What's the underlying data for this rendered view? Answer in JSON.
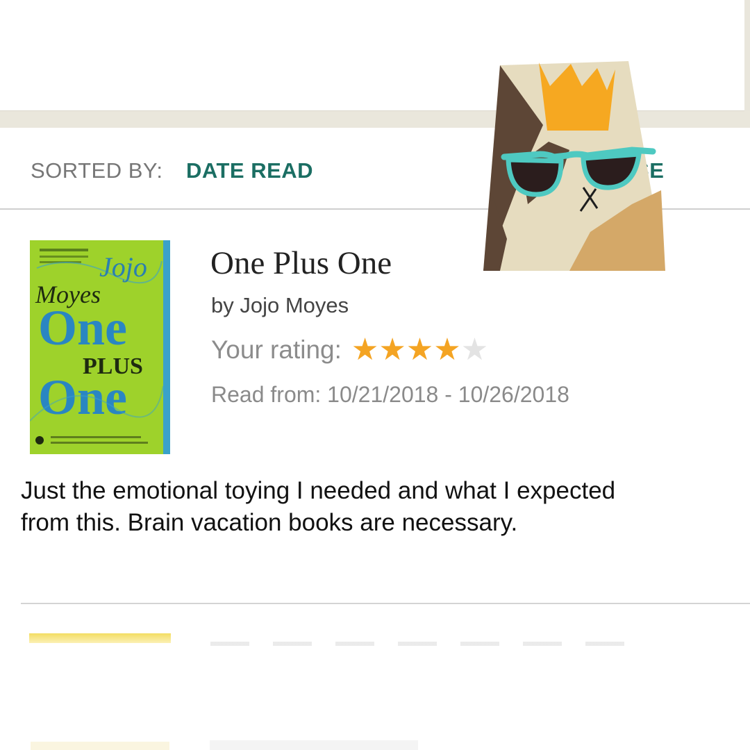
{
  "sort_bar": {
    "label": "SORTED BY:",
    "value": "DATE READ",
    "reverse_label": "ERSE"
  },
  "book": {
    "cover": {
      "author_first": "Jojo",
      "author_last": "Moyes",
      "title_line1": "One",
      "title_line2": "PLUS",
      "title_line3": "One"
    },
    "title": "One Plus One",
    "author": "by Jojo Moyes",
    "rating_label": "Your rating:",
    "rating": 4,
    "rating_max": 5,
    "read_dates": "Read from: 10/21/2018 - 10/26/2018",
    "review": "Just the emotional toying I needed and what I expected from this. Brain vacation books are necessary."
  },
  "colors": {
    "accent_teal": "#1b6e63",
    "star_on": "#f4a423",
    "star_off": "#e3e3e3",
    "cover_green": "#9ed22b",
    "cover_blue": "#3aa2c9"
  },
  "icons": {
    "sticker": "cat-with-crown-and-sunglasses"
  }
}
